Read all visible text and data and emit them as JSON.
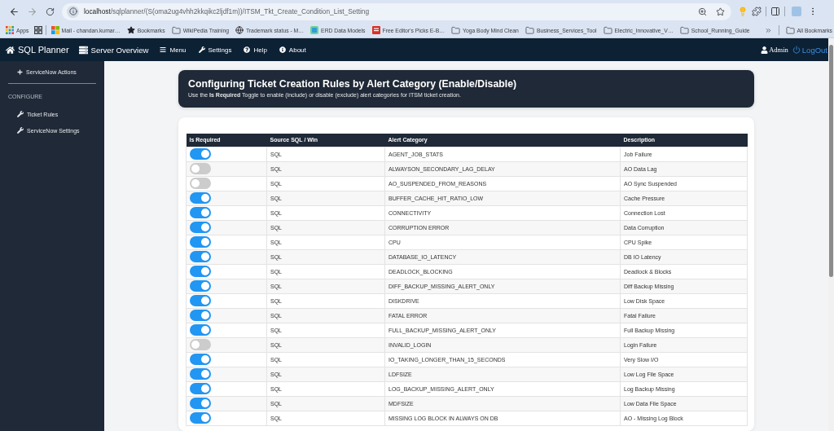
{
  "browser": {
    "url_host": "localhost",
    "url_path": "/sqlplanner/(S(oma2ug4vhh2kkqikc2ljdf1m))/ITSM_Tkt_Create_Condition_List_Setting"
  },
  "bookmarks": [
    {
      "kind": "apps",
      "label": "Apps"
    },
    {
      "kind": "tiles",
      "label": "Mail - chandan.kumar…"
    },
    {
      "kind": "star",
      "label": "Bookmarks"
    },
    {
      "kind": "folder",
      "label": "WikiPedia Training"
    },
    {
      "kind": "globe",
      "label": "Trademark status - M…"
    },
    {
      "kind": "diagram",
      "label": "ERD Data Models"
    },
    {
      "kind": "document",
      "label": "Free Editor's Picks E-B…"
    },
    {
      "kind": "folder",
      "label": "Yoga Body Mind Clean"
    },
    {
      "kind": "folder",
      "label": "Business_Services_Tool"
    },
    {
      "kind": "folder",
      "label": "Electric_Innovative_V…"
    },
    {
      "kind": "folder",
      "label": "School_Running_Guide"
    }
  ],
  "all_bookmarks": "All Bookmarks",
  "navbar": {
    "brand": "SQL Planner",
    "items": [
      {
        "kind": "server",
        "label": "Server Overview"
      },
      {
        "kind": "menu",
        "label": "Menu"
      },
      {
        "kind": "wrench",
        "label": "Settings"
      },
      {
        "kind": "help",
        "label": "Help"
      },
      {
        "kind": "info",
        "label": "About"
      }
    ],
    "user": "Admin",
    "logout": "LogOut"
  },
  "sidebar": {
    "items": [
      {
        "kind": "plus",
        "label": "ServiceNow Actions"
      }
    ],
    "section": "CONFIGURE",
    "section_items": [
      {
        "kind": "wrench",
        "label": "Ticket Rules"
      },
      {
        "kind": "wrench",
        "label": "ServiceNow Settings"
      }
    ]
  },
  "header": {
    "title": "Configuring Ticket Creation Rules by Alert Category (Enable/Disable)",
    "subtitle": "Use the **Is Required** Toggle to enable (include) or disable (exclude) alert categories for ITSM ticket creation."
  },
  "table": {
    "columns": [
      "Is Required",
      "Source SQL / Win",
      "Alert Category",
      "Description"
    ],
    "rows": [
      {
        "required": true,
        "source": "SQL",
        "category": "AGENT_JOB_STATS",
        "description": "Job Failure"
      },
      {
        "required": false,
        "source": "SQL",
        "category": "ALWAYSON_SECONDARY_LAG_DELAY",
        "description": "AO Data Lag"
      },
      {
        "required": false,
        "source": "SQL",
        "category": "AO_SUSPENDED_FROM_REASONS",
        "description": "AO Sync Suspended"
      },
      {
        "required": true,
        "source": "SQL",
        "category": "BUFFER_CACHE_HIT_RATIO_LOW",
        "description": "Cache Pressure"
      },
      {
        "required": true,
        "source": "SQL",
        "category": "CONNECTIVITY",
        "description": "Connection Lost"
      },
      {
        "required": true,
        "source": "SQL",
        "category": "CORRUPTION ERROR",
        "description": "Data Corruption"
      },
      {
        "required": true,
        "source": "SQL",
        "category": "CPU",
        "description": "CPU Spike"
      },
      {
        "required": true,
        "source": "SQL",
        "category": "DATABASE_IO_LATENCY",
        "description": "DB IO Latency"
      },
      {
        "required": true,
        "source": "SQL",
        "category": "DEADLOCK_BLOCKING",
        "description": "Deadlock & Blocks"
      },
      {
        "required": true,
        "source": "SQL",
        "category": "DIFF_BACKUP_MISSING_ALERT_ONLY",
        "description": "Diff Backup Missing"
      },
      {
        "required": true,
        "source": "SQL",
        "category": "DISKDRIVE",
        "description": "Low Disk Space"
      },
      {
        "required": true,
        "source": "SQL",
        "category": "FATAL ERROR",
        "description": "Fatal Failure"
      },
      {
        "required": true,
        "source": "SQL",
        "category": "FULL_BACKUP_MISSING_ALERT_ONLY",
        "description": "Full Backup Missing"
      },
      {
        "required": false,
        "source": "SQL",
        "category": "INVALID_LOGIN",
        "description": "Login Failure"
      },
      {
        "required": true,
        "source": "SQL",
        "category": "IO_TAKING_LONGER_THAN_15_SECONDS",
        "description": "Very Slow I/O"
      },
      {
        "required": true,
        "source": "SQL",
        "category": "LDFSIZE",
        "description": "Low Log File Space"
      },
      {
        "required": true,
        "source": "SQL",
        "category": "LOG_BACKUP_MISSING_ALERT_ONLY",
        "description": "Log Backup Missing"
      },
      {
        "required": true,
        "source": "SQL",
        "category": "MDFSIZE",
        "description": "Low Data File Space"
      },
      {
        "required": true,
        "source": "SQL",
        "category": "MISSING LOG BLOCK IN ALWAYS ON DB",
        "description": "AO - Missing Log Block"
      }
    ]
  }
}
